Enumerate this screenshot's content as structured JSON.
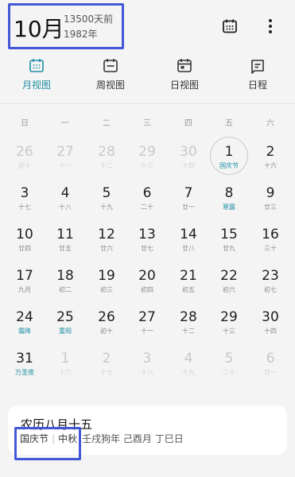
{
  "header": {
    "month": "10月",
    "days_ago": "13500天前",
    "year": "1982年"
  },
  "icons": {
    "calendar": "calendar-icon",
    "more": "more-vertical-icon"
  },
  "tabs": [
    {
      "label": "月视图",
      "icon": "month-view-icon",
      "active": true
    },
    {
      "label": "周视图",
      "icon": "week-view-icon",
      "active": false
    },
    {
      "label": "日视图",
      "icon": "day-view-icon",
      "active": false
    },
    {
      "label": "日程",
      "icon": "schedule-icon",
      "active": false
    }
  ],
  "weekdays": [
    "日",
    "一",
    "二",
    "三",
    "四",
    "五",
    "六"
  ],
  "days": [
    {
      "d": "26",
      "l": "初十",
      "other": true
    },
    {
      "d": "27",
      "l": "十一",
      "other": true
    },
    {
      "d": "28",
      "l": "十二",
      "other": true
    },
    {
      "d": "29",
      "l": "十三",
      "other": true
    },
    {
      "d": "30",
      "l": "十四",
      "other": true
    },
    {
      "d": "1",
      "l": "国庆节",
      "today": true
    },
    {
      "d": "2",
      "l": "十六"
    },
    {
      "d": "3",
      "l": "十七"
    },
    {
      "d": "4",
      "l": "十八"
    },
    {
      "d": "5",
      "l": "十九"
    },
    {
      "d": "6",
      "l": "二十"
    },
    {
      "d": "7",
      "l": "廿一"
    },
    {
      "d": "8",
      "l": "寒露",
      "fest": true
    },
    {
      "d": "9",
      "l": "廿三"
    },
    {
      "d": "10",
      "l": "廿四"
    },
    {
      "d": "11",
      "l": "廿五"
    },
    {
      "d": "12",
      "l": "廿六"
    },
    {
      "d": "13",
      "l": "廿七"
    },
    {
      "d": "14",
      "l": "廿八"
    },
    {
      "d": "15",
      "l": "廿九"
    },
    {
      "d": "16",
      "l": "三十"
    },
    {
      "d": "17",
      "l": "九月"
    },
    {
      "d": "18",
      "l": "初二"
    },
    {
      "d": "19",
      "l": "初三"
    },
    {
      "d": "20",
      "l": "初四"
    },
    {
      "d": "21",
      "l": "初五"
    },
    {
      "d": "22",
      "l": "初六"
    },
    {
      "d": "23",
      "l": "初七"
    },
    {
      "d": "24",
      "l": "霜降",
      "fest": true
    },
    {
      "d": "25",
      "l": "重阳",
      "fest": true
    },
    {
      "d": "26",
      "l": "初十"
    },
    {
      "d": "27",
      "l": "十一"
    },
    {
      "d": "28",
      "l": "十二"
    },
    {
      "d": "29",
      "l": "十三"
    },
    {
      "d": "30",
      "l": "十四"
    },
    {
      "d": "31",
      "l": "万圣夜",
      "fest": true
    },
    {
      "d": "1",
      "l": "十六",
      "other": true
    },
    {
      "d": "2",
      "l": "十七",
      "other": true
    },
    {
      "d": "3",
      "l": "十八",
      "other": true
    },
    {
      "d": "4",
      "l": "十九",
      "other": true
    },
    {
      "d": "5",
      "l": "二十",
      "other": true
    },
    {
      "d": "6",
      "l": "廿一",
      "other": true
    }
  ],
  "info": {
    "lunar_date": "农历八月十五",
    "tag1": "国庆节",
    "separator": "|",
    "tag2": "中秋",
    "ganzhi": "壬戌狗年 己酉月 丁巳日"
  },
  "colors": {
    "accent": "#1f8fa5",
    "highlight_box": "#4358d6"
  }
}
